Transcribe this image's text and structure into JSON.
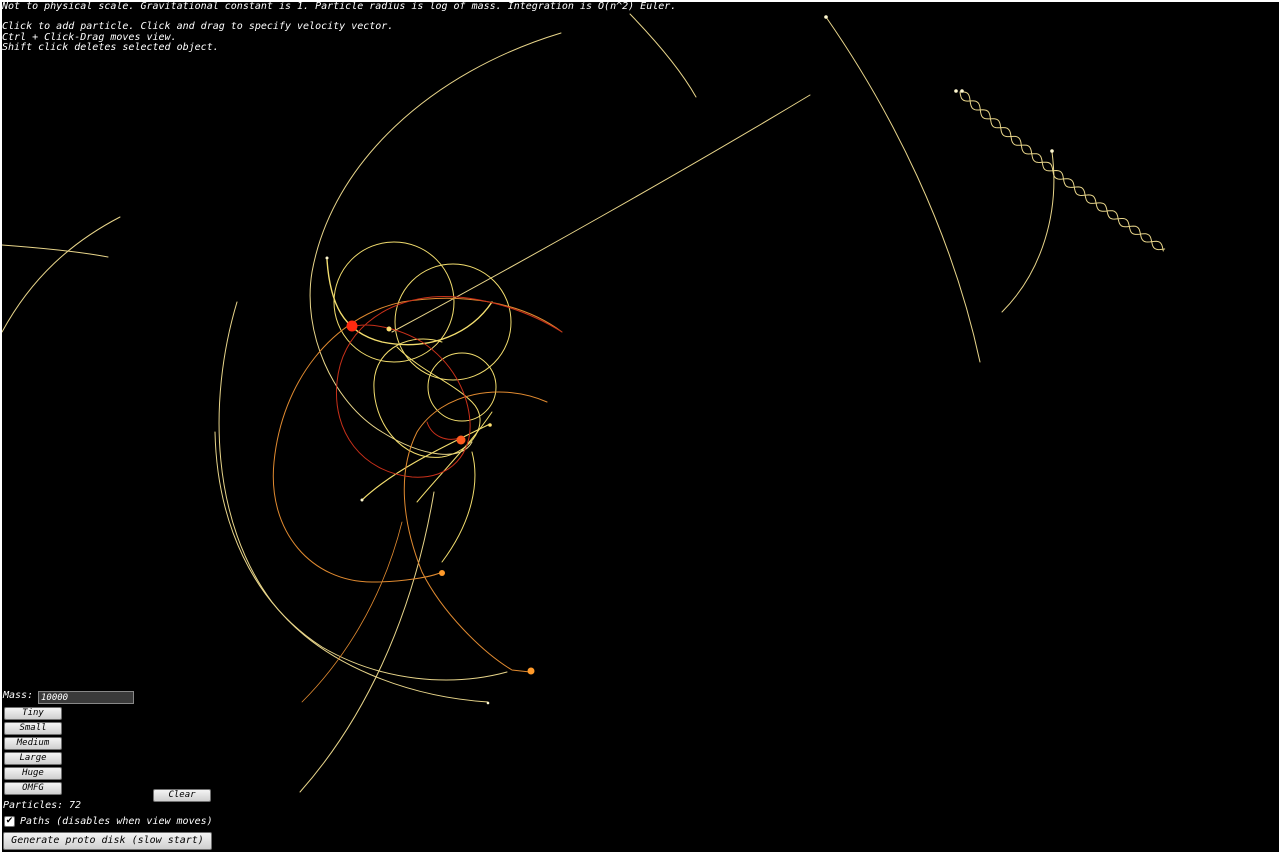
{
  "info": {
    "lines": [
      "Not to physical scale. Gravitational constant is 1. Particle radius is log of mass. Integration is O(n^2) Euler.",
      "Click to add particle. Click and drag to specify velocity vector.",
      "Ctrl + Click-Drag moves view.",
      "Shift click deletes selected object."
    ]
  },
  "controls": {
    "mass_label": "Mass:",
    "mass_value": "10000",
    "size_buttons": [
      "Tiny",
      "Small",
      "Medium",
      "Large",
      "Huge",
      "OMFG"
    ],
    "clear_label": "Clear",
    "particles_label": "Particles:",
    "particles_count": "72",
    "paths_checked": true,
    "paths_check_glyph": "✔",
    "paths_label": "Paths (disables when view moves)",
    "proto_disk_label": "Generate proto disk (slow start)"
  },
  "colors": {
    "background": "#000000",
    "path_pale": "#e8d58a",
    "path_yellow": "#f2dd6e",
    "path_orange": "#e08a30",
    "path_red": "#c8301a",
    "particle_red": "#ff2a10",
    "particle_orange_red": "#ff5a1e",
    "particle_orange": "#ff9a2a",
    "particle_yellow": "#ffe070",
    "particle_white": "#fff8d0"
  },
  "icons": {
    "checkbox": "checkmark-icon"
  }
}
